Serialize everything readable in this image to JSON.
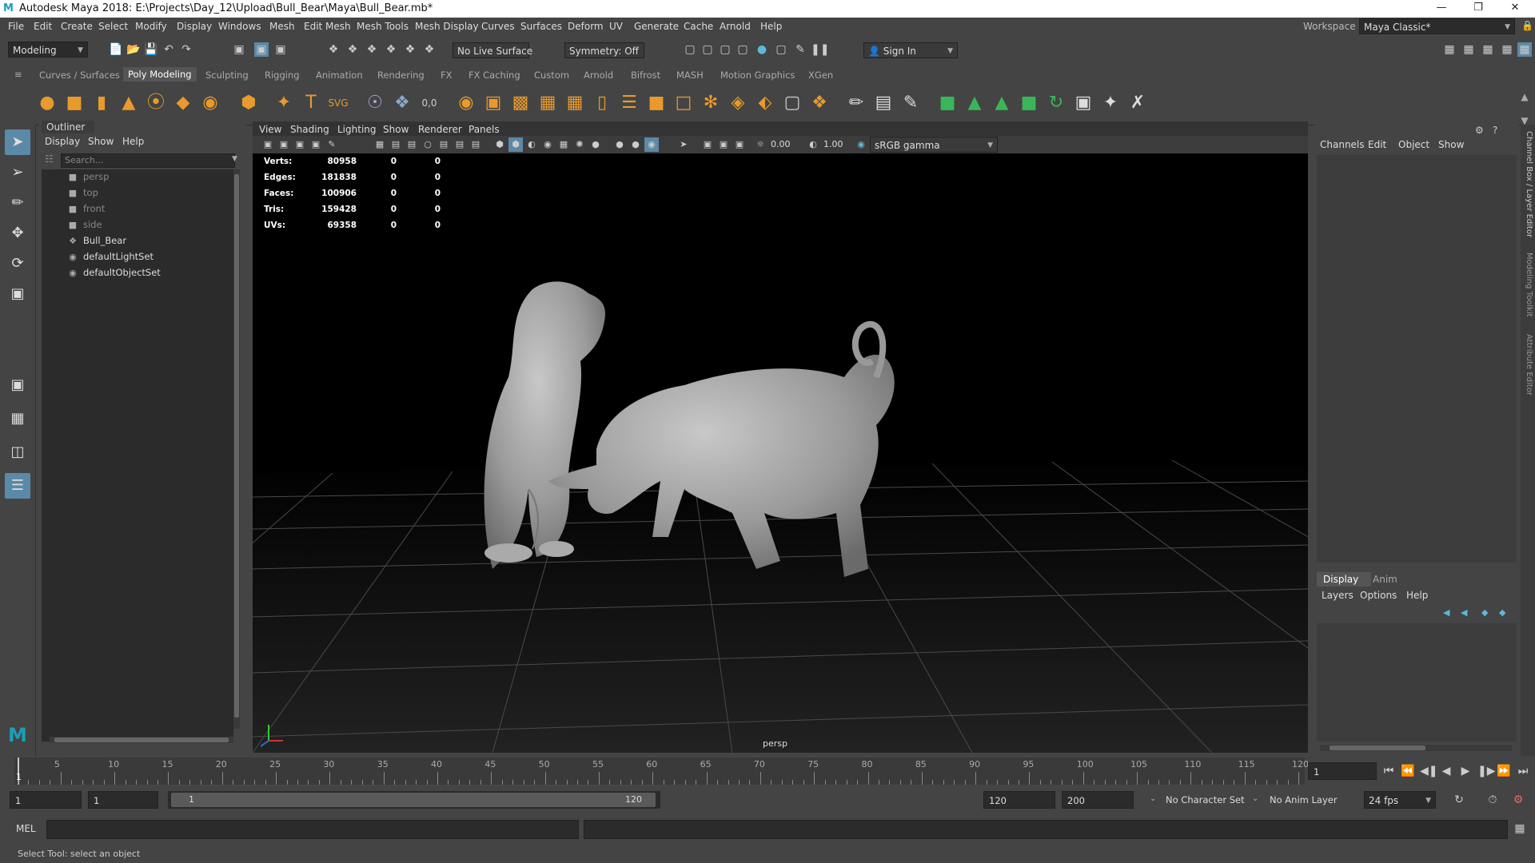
{
  "window": {
    "title": "Autodesk Maya 2018: E:\\Projects\\Day_12\\Upload\\Bull_Bear\\Maya\\Bull_Bear.mb*"
  },
  "menubar": {
    "items": [
      "File",
      "Edit",
      "Create",
      "Select",
      "Modify",
      "Display",
      "Windows",
      "Mesh",
      "Edit Mesh",
      "Mesh Tools",
      "Mesh Display",
      "Curves",
      "Surfaces",
      "Deform",
      "UV",
      "Generate",
      "Cache",
      "Arnold",
      "Help"
    ],
    "workspace_label": "Workspace :",
    "workspace_value": "Maya Classic*"
  },
  "statusline": {
    "mode": "Modeling",
    "live_surface": "No Live Surface",
    "symmetry": "Symmetry: Off",
    "sign_in": "Sign In"
  },
  "shelf": {
    "tabs": [
      "Curves / Surfaces",
      "Poly Modeling",
      "Sculpting",
      "Rigging",
      "Animation",
      "Rendering",
      "FX",
      "FX Caching",
      "Custom",
      "Arnold",
      "Bifrost",
      "MASH",
      "Motion Graphics",
      "XGen"
    ],
    "active_tab": "Poly Modeling"
  },
  "outliner": {
    "title": "Outliner",
    "menus": [
      "Display",
      "Show",
      "Help"
    ],
    "search_placeholder": "Search...",
    "items": [
      {
        "label": "persp",
        "dim": true,
        "icon": "camera-icon"
      },
      {
        "label": "top",
        "dim": true,
        "icon": "camera-icon"
      },
      {
        "label": "front",
        "dim": true,
        "icon": "camera-icon"
      },
      {
        "label": "side",
        "dim": true,
        "icon": "camera-icon"
      },
      {
        "label": "Bull_Bear",
        "dim": false,
        "icon": "transform-icon"
      },
      {
        "label": "defaultLightSet",
        "dim": false,
        "icon": "set-icon"
      },
      {
        "label": "defaultObjectSet",
        "dim": false,
        "icon": "set-icon"
      }
    ]
  },
  "viewport": {
    "menus": [
      "View",
      "Shading",
      "Lighting",
      "Show",
      "Renderer",
      "Panels"
    ],
    "exposure": "0.00",
    "gamma": "1.00",
    "color_space": "sRGB gamma",
    "camera_label": "persp",
    "hud": [
      {
        "label": "Verts:",
        "v1": "80958",
        "v2": "0",
        "v3": "0"
      },
      {
        "label": "Edges:",
        "v1": "181838",
        "v2": "0",
        "v3": "0"
      },
      {
        "label": "Faces:",
        "v1": "100906",
        "v2": "0",
        "v3": "0"
      },
      {
        "label": "Tris:",
        "v1": "159428",
        "v2": "0",
        "v3": "0"
      },
      {
        "label": "UVs:",
        "v1": "69358",
        "v2": "0",
        "v3": "0"
      }
    ]
  },
  "channelbox": {
    "menus": [
      "Channels",
      "Edit",
      "Object",
      "Show"
    ],
    "layer_tabs": [
      "Display",
      "Anim"
    ],
    "layer_menus": [
      "Layers",
      "Options",
      "Help"
    ],
    "side_tabs": [
      "Channel Box / Layer Editor",
      "Modeling Toolkit",
      "Attribute Editor"
    ]
  },
  "timeline": {
    "ticks": [
      "5",
      "10",
      "15",
      "20",
      "25",
      "30",
      "35",
      "40",
      "45",
      "50",
      "55",
      "60",
      "65",
      "70",
      "75",
      "80",
      "85",
      "90",
      "95",
      "100",
      "105",
      "110",
      "115",
      "120"
    ],
    "current_frame": "1",
    "frame_field": "1"
  },
  "range": {
    "start": "1",
    "playback_start": "1",
    "slider_start": "1",
    "slider_end": "120",
    "playback_end": "120",
    "end": "200",
    "character_set": "No Character Set",
    "anim_layer": "No Anim Layer",
    "fps": "24 fps"
  },
  "cmdline": {
    "label": "MEL"
  },
  "helpline": {
    "text": "Select Tool: select an object"
  },
  "colors": {
    "accent": "#5b89a8",
    "maya_logo": "#1a9fb8"
  }
}
